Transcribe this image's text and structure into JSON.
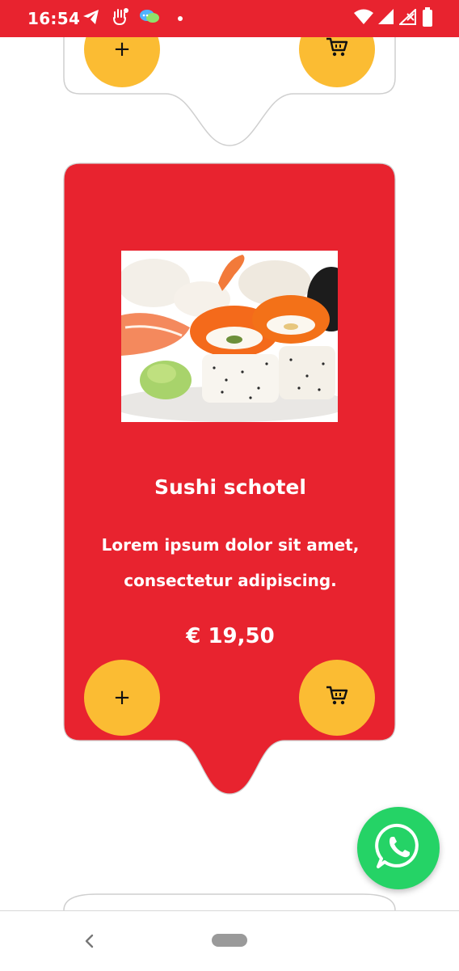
{
  "status_bar": {
    "time": "16:54",
    "left_icons": [
      "telegram-icon",
      "hand-icon",
      "messaging-icon",
      "dot-icon"
    ],
    "right_icons": [
      "wifi-icon",
      "signal-icon",
      "signal-off-icon",
      "battery-icon"
    ]
  },
  "colors": {
    "brand_red": "#e8232f",
    "button_yellow": "#fbbc33",
    "whatsapp_green": "#25d366"
  },
  "top_card": {
    "add_label": "+",
    "cart_icon": "cart-icon"
  },
  "product": {
    "title": "Sushi schotel",
    "description": "Lorem ipsum dolor sit amet, consectetur adipiscing.",
    "price": "€ 19,50",
    "add_label": "+",
    "cart_icon": "cart-icon",
    "image": "sushi-plate-image"
  },
  "whatsapp": {
    "icon": "whatsapp-icon"
  },
  "nav": {
    "back_icon": "back-chevron-icon",
    "home_icon": "home-pill-icon"
  }
}
